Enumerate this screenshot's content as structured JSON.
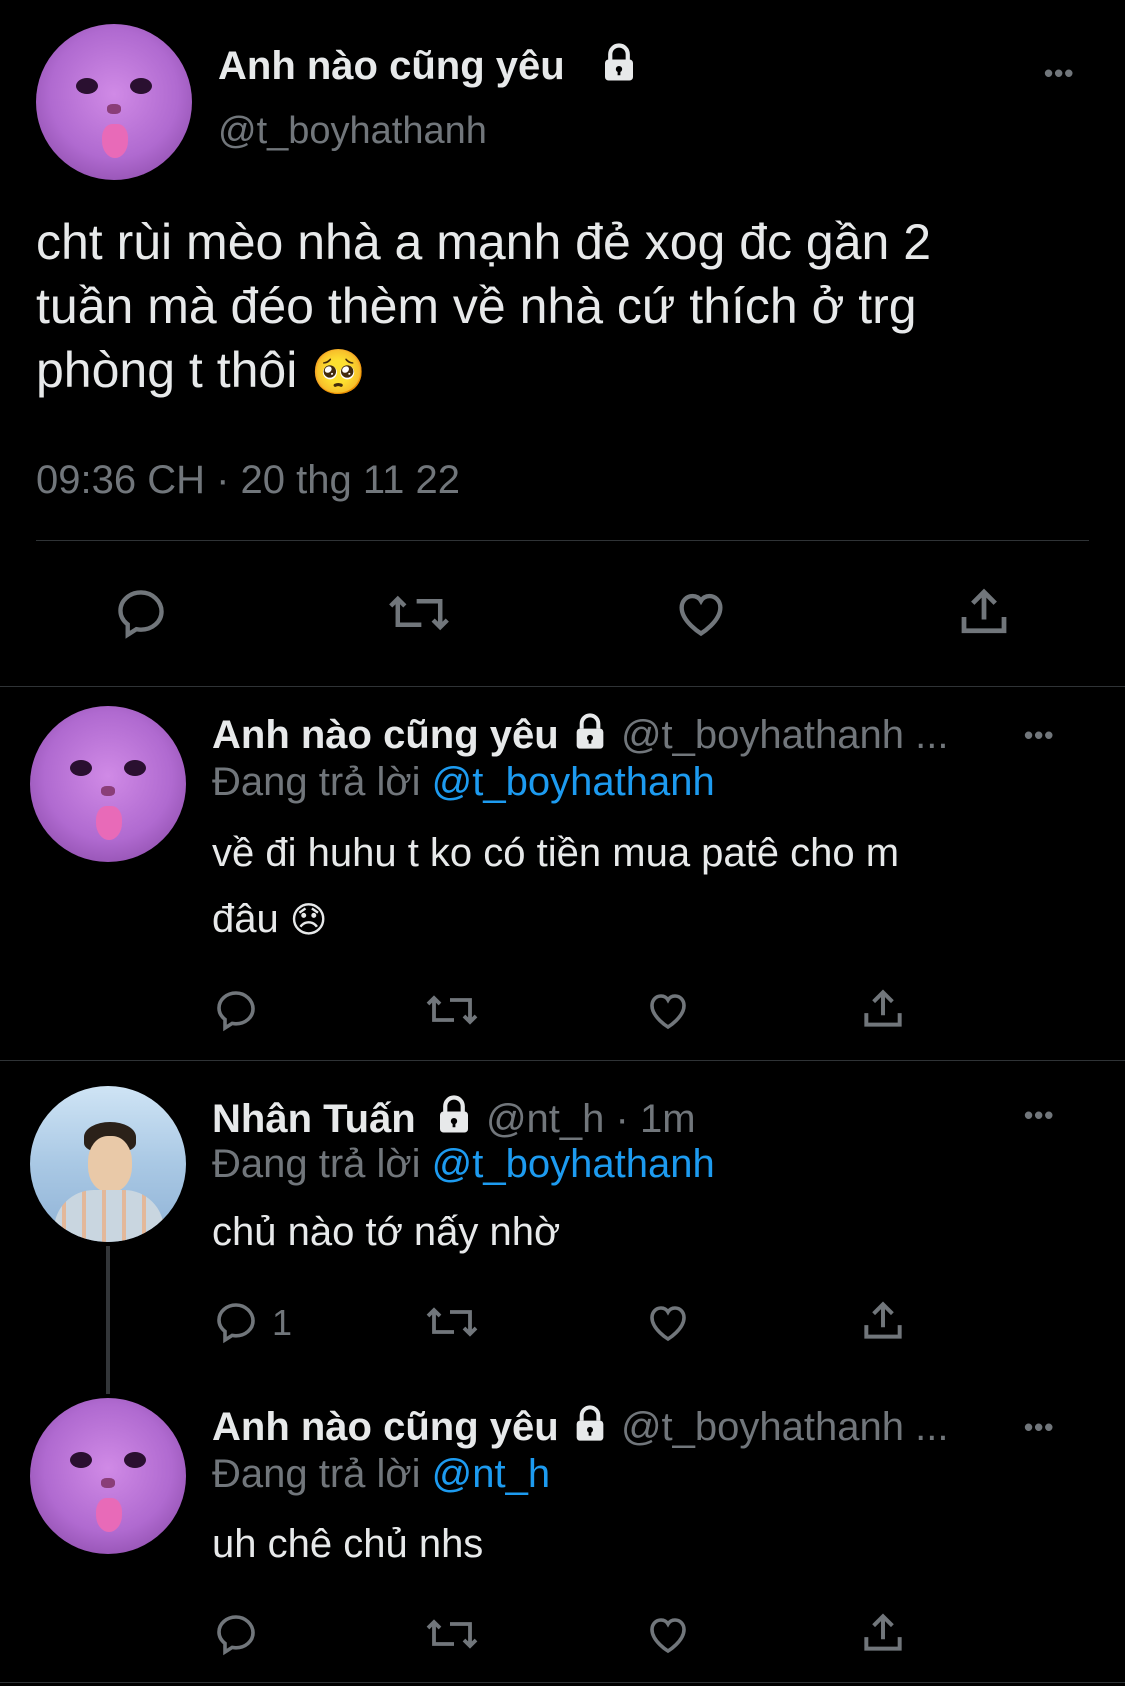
{
  "main_tweet": {
    "display_name": "Anh nào cũng yêu",
    "handle": "@t_boyhathanh",
    "text_line1": "cht rùi mèo nhà a mạnh đẻ xog đc gần 2",
    "text_line2": "tuần mà đéo thèm về nhà cứ thích ở trg",
    "text_line3": "phòng t thôi",
    "emoji": "🥺",
    "timestamp": "09:36 CH · 20 thg 11 22",
    "more": "•••"
  },
  "replies": [
    {
      "display_name": "Anh nào cũng yêu",
      "handle_meta": "@t_boyhathanh ...",
      "replying_label": "Đang trả lời",
      "replying_to": "@t_boyhathanh",
      "text_line1": "về đi huhu t ko có tiền mua patê cho m",
      "text_line2": "đâu",
      "emoji": "😞",
      "reply_count": "",
      "more": "•••"
    },
    {
      "display_name": "Nhân Tuấn",
      "handle_meta": "@nt_h · 1m",
      "replying_label": "Đang trả lời",
      "replying_to": "@t_boyhathanh",
      "text_line1": "chủ nào tớ nấy nhờ",
      "reply_count": "1",
      "more": "•••"
    },
    {
      "display_name": "Anh nào cũng yêu",
      "handle_meta": "@t_boyhathanh ...",
      "replying_label": "Đang trả lời",
      "replying_to": "@nt_h",
      "text_line1": "uh chê chủ nhs",
      "reply_count": "",
      "more": "•••"
    }
  ],
  "icons": [
    "reply-icon",
    "retweet-icon",
    "like-icon",
    "share-icon",
    "lock-icon",
    "more-icon"
  ],
  "colors": {
    "background": "#000000",
    "text": "#e7e9ea",
    "muted": "#71767b",
    "link": "#1d9bf0",
    "divider": "#2f3336"
  }
}
